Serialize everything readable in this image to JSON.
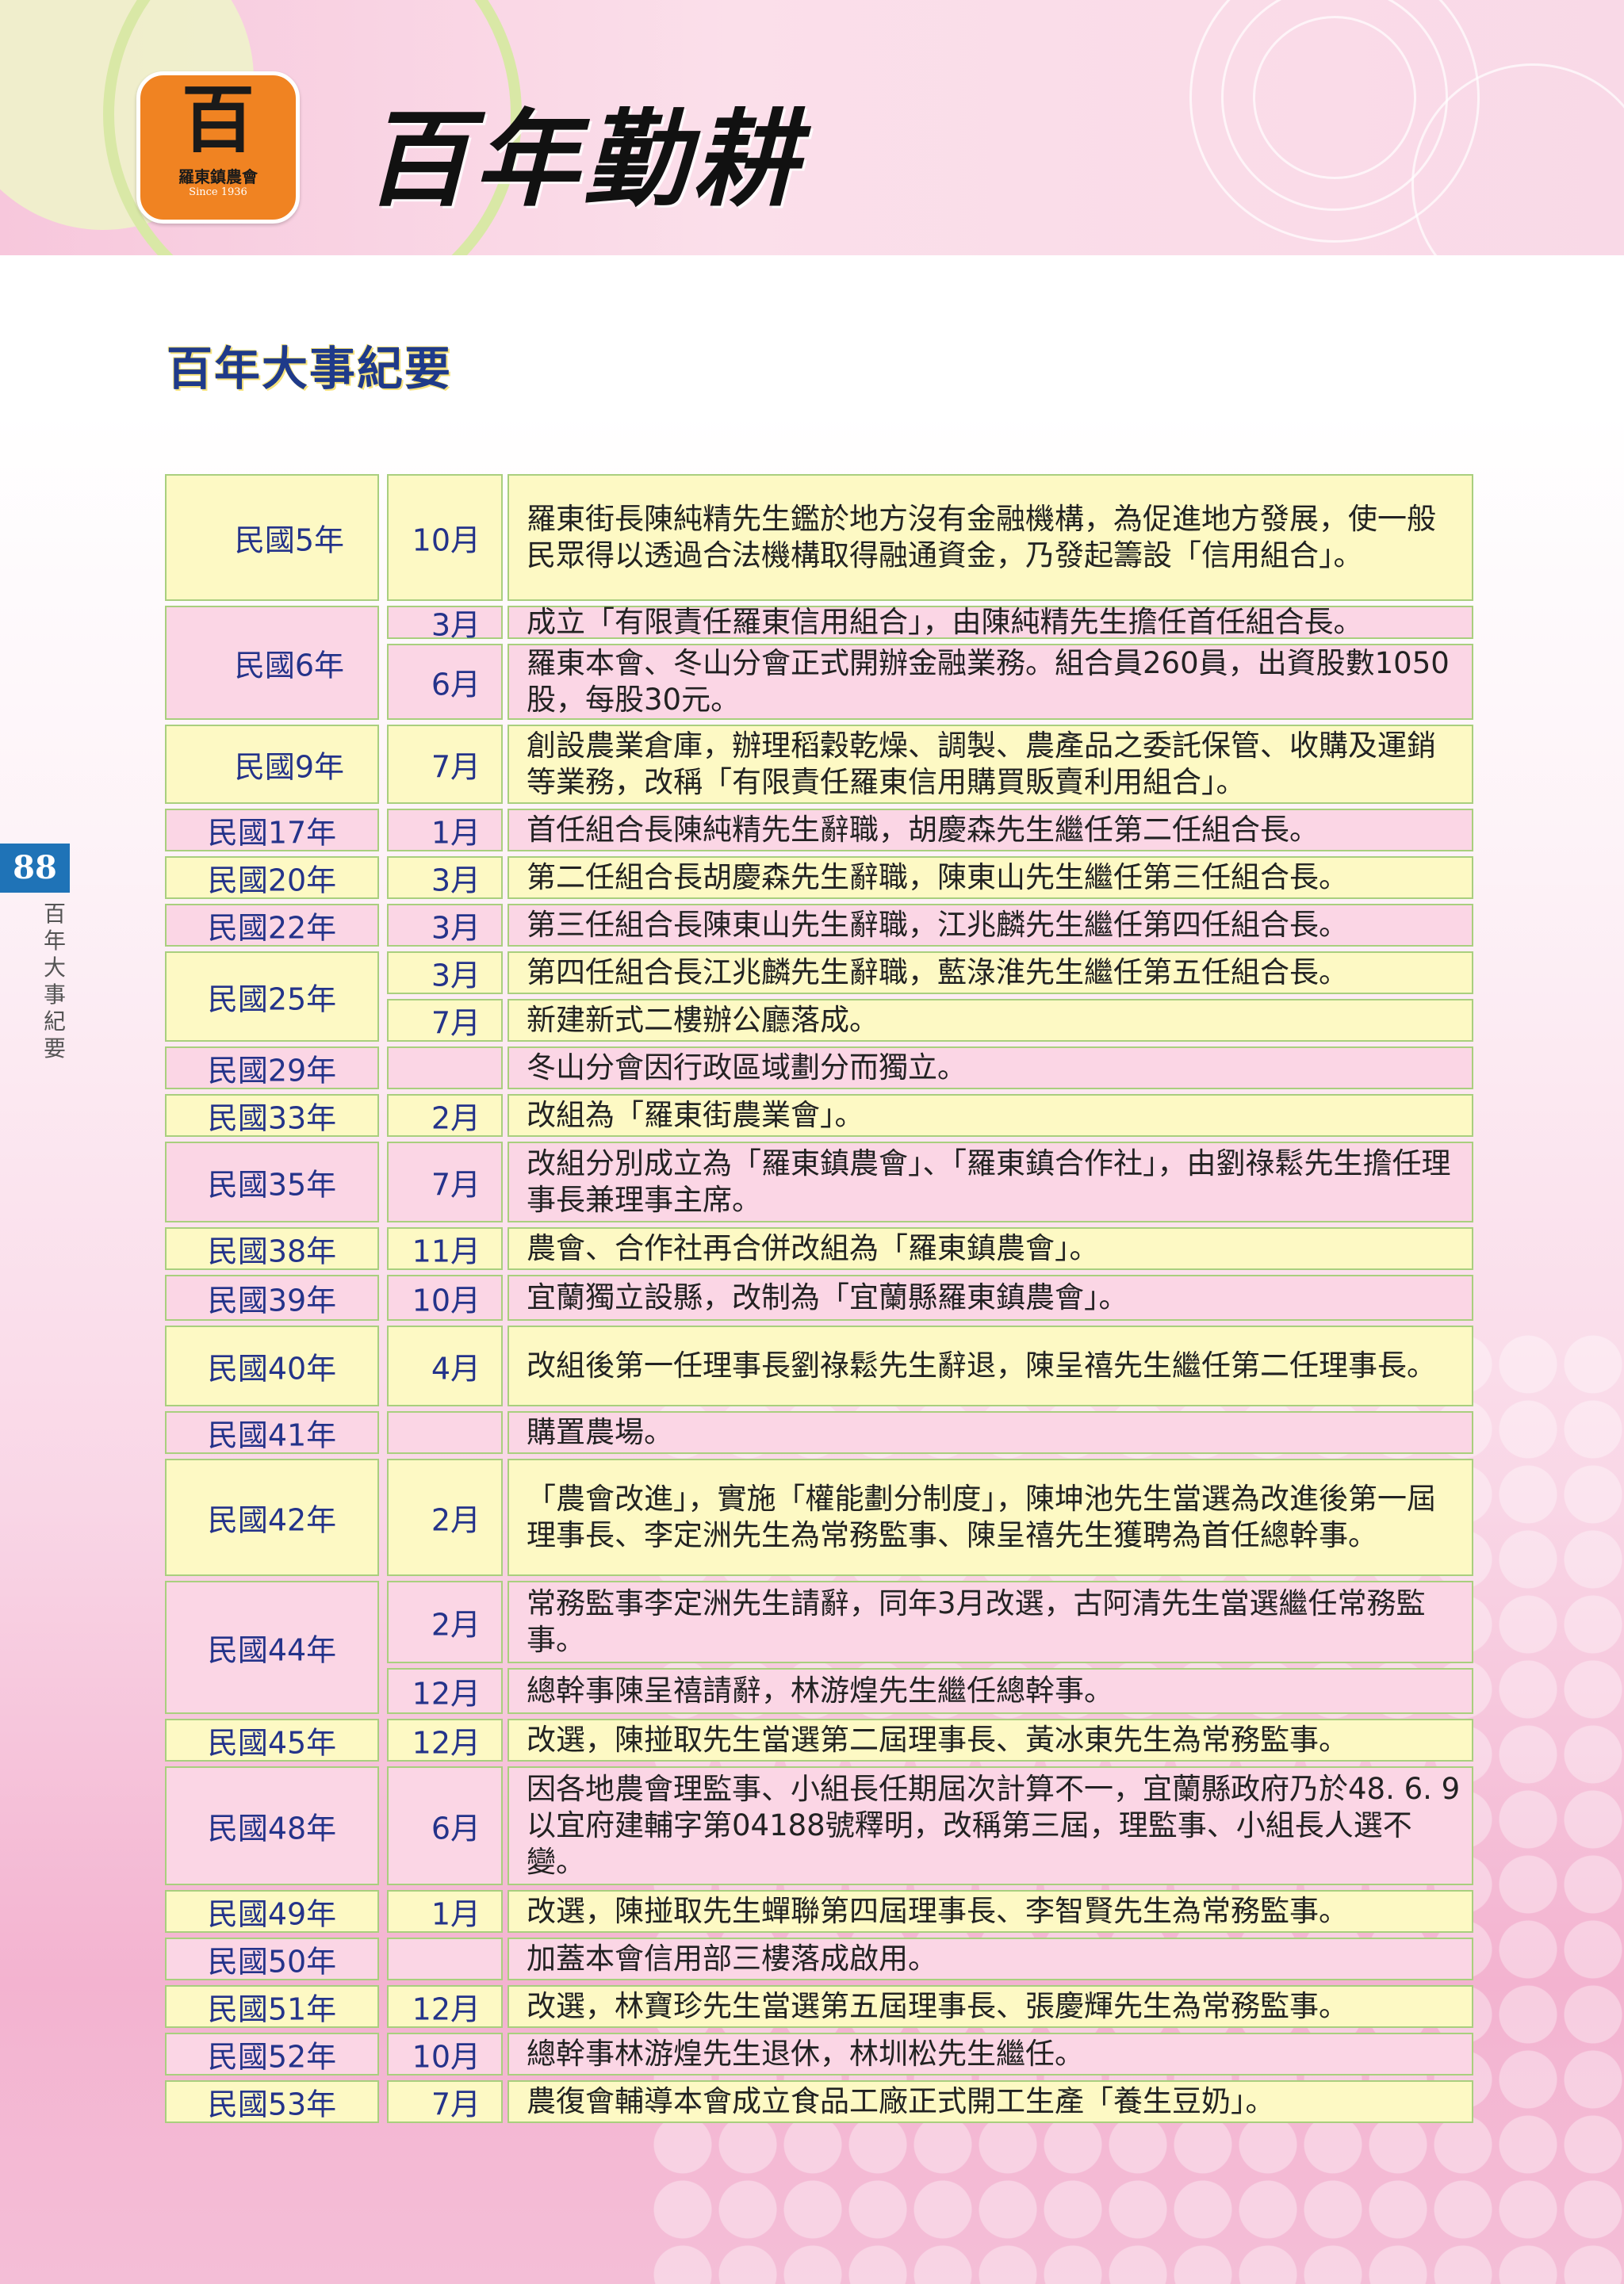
{
  "header": {
    "logo_char": "百",
    "logo_name": "羅東鎮農會",
    "logo_since": "Since 1936",
    "calligraphy": "百年勤耕"
  },
  "page_title": "百年大事紀要",
  "side": {
    "page_number": "88",
    "section": "百年大事紀要"
  },
  "events": [
    {
      "year": "民國5年",
      "month": "10月",
      "text": "羅東街長陳純精先生鑑於地方沒有金融機構，為促進地方發展，使一般民眾得以透過合法機構取得融通資金，乃發起籌設「信用組合」。"
    },
    {
      "year": "民國6年",
      "month": "3月",
      "text": "成立「有限責任羅東信用組合」，由陳純精先生擔任首任組合長。"
    },
    {
      "year": "",
      "month": "6月",
      "text": "羅東本會、冬山分會正式開辦金融業務。組合員260員，出資股數1050股，每股30元。"
    },
    {
      "year": "民國9年",
      "month": "7月",
      "text": "創設農業倉庫，辦理稻穀乾燥、調製、農產品之委託保管、收購及運銷等業務，改稱「有限責任羅東信用購買販賣利用組合」。"
    },
    {
      "year": "民國17年",
      "month": "1月",
      "text": "首任組合長陳純精先生辭職，胡慶森先生繼任第二任組合長。"
    },
    {
      "year": "民國20年",
      "month": "3月",
      "text": "第二任組合長胡慶森先生辭職，陳東山先生繼任第三任組合長。"
    },
    {
      "year": "民國22年",
      "month": "3月",
      "text": "第三任組合長陳東山先生辭職，江兆麟先生繼任第四任組合長。"
    },
    {
      "year": "民國25年",
      "month": "3月",
      "text": "第四任組合長江兆麟先生辭職，藍淥淮先生繼任第五任組合長。"
    },
    {
      "year": "",
      "month": "7月",
      "text": "新建新式二樓辦公廳落成。"
    },
    {
      "year": "民國29年",
      "month": "",
      "text": "冬山分會因行政區域劃分而獨立。"
    },
    {
      "year": "民國33年",
      "month": "2月",
      "text": "改組為「羅東街農業會」。"
    },
    {
      "year": "民國35年",
      "month": "7月",
      "text": "改組分別成立為「羅東鎮農會」、「羅東鎮合作社」，由劉祿鬆先生擔任理事長兼理事主席。"
    },
    {
      "year": "民國38年",
      "month": "11月",
      "text": "農會、合作社再合併改組為「羅東鎮農會」。"
    },
    {
      "year": "民國39年",
      "month": "10月",
      "text": "宜蘭獨立設縣，改制為「宜蘭縣羅東鎮農會」。"
    },
    {
      "year": "民國40年",
      "month": "4月",
      "text": "改組後第一任理事長劉祿鬆先生辭退，陳呈禧先生繼任第二任理事長。"
    },
    {
      "year": "民國41年",
      "month": "",
      "text": "購置農場。"
    },
    {
      "year": "民國42年",
      "month": "2月",
      "text": "「農會改進」，實施「權能劃分制度」，陳坤池先生當選為改進後第一屆理事長、李定洲先生為常務監事、陳呈禧先生獲聘為首任總幹事。"
    },
    {
      "year": "民國44年",
      "month": "2月",
      "text": "常務監事李定洲先生請辭，同年3月改選，古阿清先生當選繼任常務監事。"
    },
    {
      "year": "",
      "month": "12月",
      "text": "總幹事陳呈禧請辭，林游煌先生繼任總幹事。"
    },
    {
      "year": "民國45年",
      "month": "12月",
      "text": "改選，陳掽取先生當選第二屆理事長、黃冰東先生為常務監事。"
    },
    {
      "year": "民國48年",
      "month": "6月",
      "text": "因各地農會理監事、小組長任期屆次計算不一，宜蘭縣政府乃於48. 6. 9以宜府建輔字第04188號釋明，改稱第三屆，理監事、小組長人選不變。"
    },
    {
      "year": "民國49年",
      "month": "1月",
      "text": "改選，陳掽取先生蟬聯第四屆理事長、李智賢先生為常務監事。"
    },
    {
      "year": "民國50年",
      "month": "",
      "text": "加蓋本會信用部三樓落成啟用。"
    },
    {
      "year": "民國51年",
      "month": "12月",
      "text": "改選，林寶珍先生當選第五屆理事長、張慶輝先生為常務監事。"
    },
    {
      "year": "民國52年",
      "month": "10月",
      "text": "總幹事林游煌先生退休，林圳松先生繼任。"
    },
    {
      "year": "民國53年",
      "month": "7月",
      "text": "農復會輔導本會成立食品工廠正式開工生產「養生豆奶」。"
    }
  ]
}
